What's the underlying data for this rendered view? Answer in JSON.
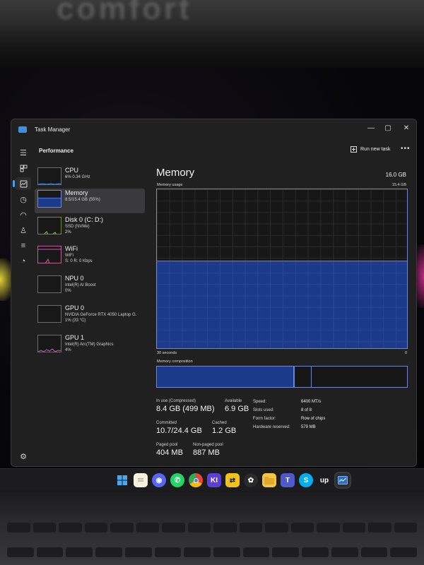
{
  "window": {
    "title": "Task Manager"
  },
  "toolbar": {
    "section_title": "Performance",
    "run_new_task": "Run new task",
    "more": "•••"
  },
  "devices": [
    {
      "name": "CPU",
      "sub1": "6%  0.34 GHz",
      "sub2": ""
    },
    {
      "name": "Memory",
      "sub1": "8.5/15.4 GB (55%)",
      "sub2": ""
    },
    {
      "name": "Disk 0 (C: D:)",
      "sub1": "SSD (NVMe)",
      "sub2": "2%"
    },
    {
      "name": "WiFi",
      "sub1": "WiFi",
      "sub2": "S: 0  R: 0 Kbps"
    },
    {
      "name": "NPU 0",
      "sub1": "Intel(R) AI Boost",
      "sub2": "0%"
    },
    {
      "name": "GPU 0",
      "sub1": "NVIDIA GeForce RTX 4050 Laptop G.",
      "sub2": "1% (33 °C)"
    },
    {
      "name": "GPU 1",
      "sub1": "Intel(R) Arc(TM) Graphics",
      "sub2": "4%"
    }
  ],
  "memory": {
    "title": "Memory",
    "total": "16.0 GB",
    "usage_label": "Memory usage",
    "usage_max": "15.4 GB",
    "usage_fraction": 0.55,
    "time_label": "30 seconds",
    "time_end": "0",
    "composition_label": "Memory composition",
    "composition": {
      "in_use_fraction": 0.55,
      "modified_fraction": 0.07
    },
    "stats": {
      "in_use_label": "In use (Compressed)",
      "in_use_value": "8.4 GB (499 MB)",
      "available_label": "Available",
      "available_value": "6.9 GB",
      "committed_label": "Committed",
      "committed_value": "10.7/24.4 GB",
      "cached_label": "Cached",
      "cached_value": "1.2 GB",
      "paged_label": "Paged pool",
      "paged_value": "404 MB",
      "nonpaged_label": "Non-paged pool",
      "nonpaged_value": "887 MB"
    },
    "details": [
      {
        "label": "Speed:",
        "value": "6400 MT/s"
      },
      {
        "label": "Slots used:",
        "value": "8 of 8"
      },
      {
        "label": "Form factor:",
        "value": "Row of chips"
      },
      {
        "label": "Hardware reserved:",
        "value": "579 MB"
      }
    ]
  },
  "taskbar": {
    "icons": [
      "windows-icon",
      "notepad-icon",
      "discord-icon",
      "whatsapp-icon",
      "chrome-icon",
      "ki-icon",
      "dev-icon",
      "chatgpt-icon",
      "file-explorer-icon",
      "teams-icon",
      "skype-icon",
      "upwork-icon",
      "task-manager-icon"
    ],
    "ki_text": "KI",
    "up_text": "up"
  },
  "background_text": "comfort",
  "colors": {
    "accent": "#1b3a8a",
    "graph_border": "#6f86c8",
    "window_bg": "#202020",
    "selection": "#3a3a3c"
  }
}
